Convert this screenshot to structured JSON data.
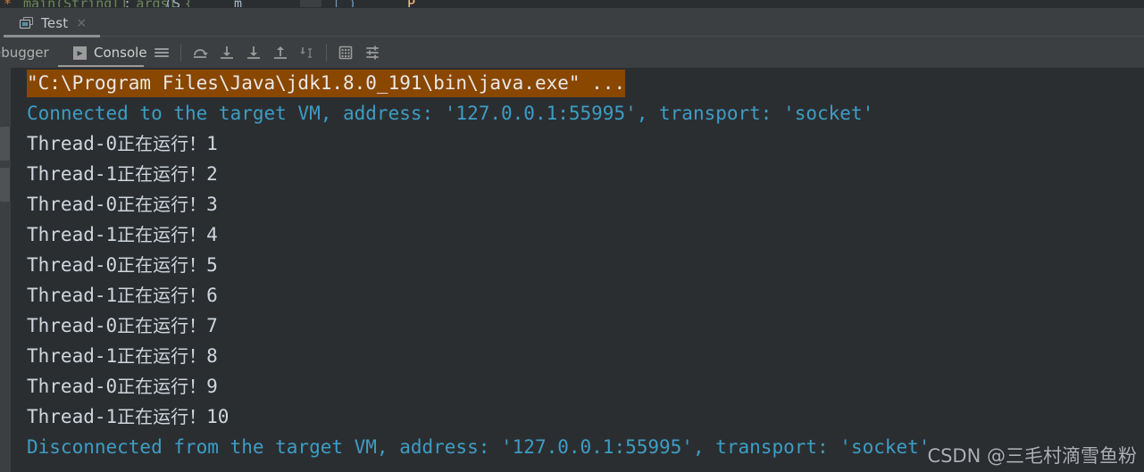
{
  "window": {
    "background_color": "#313335",
    "accent_highlight_color": "#8a4700"
  },
  "editor_sliver": {
    "fragments": [
      "*",
      "main(String[] args) {",
      "",
      "",
      "",
      "",
      "",
      ""
    ]
  },
  "tab_bar": {
    "run_tab": {
      "icon": "run-configuration-icon",
      "label": "Test",
      "close_label": "×"
    }
  },
  "toolbar": {
    "tabs": [
      {
        "label": "ebugger",
        "icon": "",
        "active": false
      },
      {
        "label": "Console",
        "icon": "console-play-icon",
        "active": true
      }
    ],
    "console_icon_glyph": "▸",
    "buttons": [
      {
        "name": "soft-wrap-lines-button",
        "icon": "hamburger-lines-icon"
      },
      {
        "name": "step-over-button",
        "icon": "step-over-icon"
      },
      {
        "name": "step-into-button",
        "icon": "step-into-icon"
      },
      {
        "name": "force-step-into-button",
        "icon": "force-step-into-icon"
      },
      {
        "name": "step-out-button",
        "icon": "step-out-icon"
      },
      {
        "name": "run-to-cursor-button",
        "icon": "run-to-cursor-icon"
      },
      {
        "name": "evaluate-expression-button",
        "icon": "calculator-icon"
      },
      {
        "name": "settings-button",
        "icon": "sliders-icon"
      }
    ]
  },
  "left_strip": {
    "buttons": [
      {
        "name": "tool-window-button-1"
      },
      {
        "name": "tool-window-button-2"
      }
    ]
  },
  "console": {
    "lines": [
      {
        "type": "command",
        "highlighted": true,
        "text": "\"C:\\Program Files\\Java\\jdk1.8.0_191\\bin\\java.exe\" ..."
      },
      {
        "type": "system",
        "highlighted": false,
        "text": "Connected to the target VM, address: '127.0.0.1:55995', transport: 'socket'"
      },
      {
        "type": "output",
        "highlighted": false,
        "prefix": "Thread-0",
        "cjk": "正在运行！",
        "value": "1"
      },
      {
        "type": "output",
        "highlighted": false,
        "prefix": "Thread-1",
        "cjk": "正在运行！",
        "value": "2"
      },
      {
        "type": "output",
        "highlighted": false,
        "prefix": "Thread-0",
        "cjk": "正在运行！",
        "value": "3"
      },
      {
        "type": "output",
        "highlighted": false,
        "prefix": "Thread-1",
        "cjk": "正在运行！",
        "value": "4"
      },
      {
        "type": "output",
        "highlighted": false,
        "prefix": "Thread-0",
        "cjk": "正在运行！",
        "value": "5"
      },
      {
        "type": "output",
        "highlighted": false,
        "prefix": "Thread-1",
        "cjk": "正在运行！",
        "value": "6"
      },
      {
        "type": "output",
        "highlighted": false,
        "prefix": "Thread-0",
        "cjk": "正在运行！",
        "value": "7"
      },
      {
        "type": "output",
        "highlighted": false,
        "prefix": "Thread-1",
        "cjk": "正在运行！",
        "value": "8"
      },
      {
        "type": "output",
        "highlighted": false,
        "prefix": "Thread-0",
        "cjk": "正在运行！",
        "value": "9"
      },
      {
        "type": "output",
        "highlighted": false,
        "prefix": "Thread-1",
        "cjk": "正在运行！",
        "value": "10"
      },
      {
        "type": "system",
        "highlighted": false,
        "text": "Disconnected from the target VM, address: '127.0.0.1:55995', transport: 'socket'"
      }
    ]
  },
  "watermark": {
    "text": "CSDN @三毛村滴雪鱼粉"
  }
}
